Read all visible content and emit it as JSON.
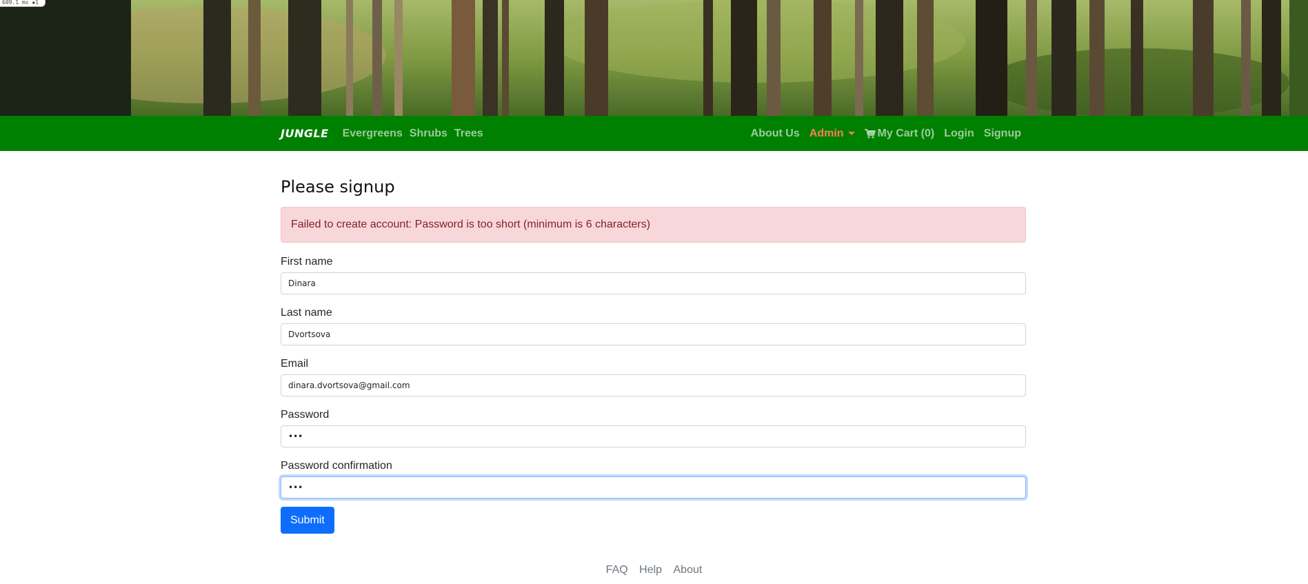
{
  "debug": {
    "text": "609.1 ms ▪1"
  },
  "nav": {
    "brand": "JUNGLE",
    "left_links": [
      "Evergreens",
      "Shrubs",
      "Trees"
    ],
    "right": {
      "about": "About Us",
      "admin": "Admin",
      "cart": "My Cart (0)",
      "login": "Login",
      "signup": "Signup"
    },
    "colors": {
      "navbar": "#008000",
      "admin": "#ff7f50"
    }
  },
  "page": {
    "title": "Please signup",
    "alert": "Failed to create account: Password is too short (minimum is 6 characters)"
  },
  "form": {
    "first_name_label": "First name",
    "first_name_value": "Dinara",
    "last_name_label": "Last name",
    "last_name_value": "Dvortsova",
    "email_label": "Email",
    "email_value": "dinara.dvortsova@gmail.com",
    "password_label": "Password",
    "password_value": "•••",
    "password_confirmation_label": "Password confirmation",
    "password_confirmation_value": "•••",
    "submit_label": "Submit"
  },
  "footer": {
    "faq": "FAQ",
    "help": "Help",
    "about": "About"
  }
}
